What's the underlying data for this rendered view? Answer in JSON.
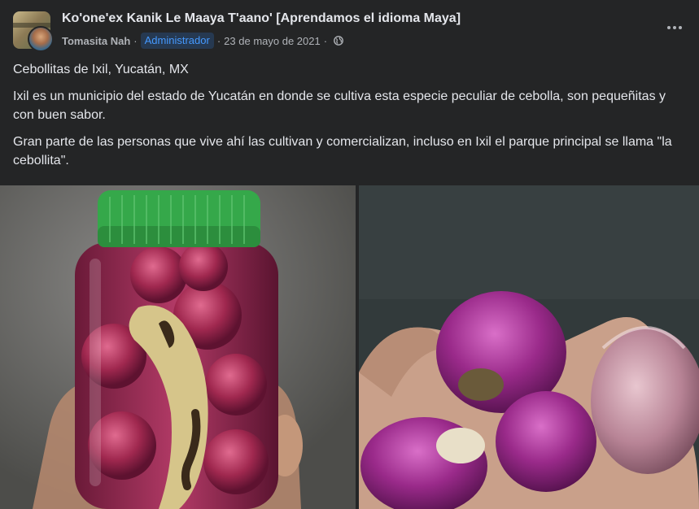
{
  "group": {
    "name": "Ko'one'ex Kanik Le Maaya T'aano' [Aprendamos el idioma Maya]"
  },
  "post": {
    "author": "Tomasita Nah",
    "role_badge": "Administrador",
    "date": "23 de mayo de 2021",
    "privacy_icon": "globe-icon",
    "more_icon": "more-options-icon",
    "paragraphs": [
      "Cebollitas de Ixil, Yucatán, MX",
      "Ixil es un municipio del estado de Yucatán en donde se cultiva esta especie peculiar de cebolla, son pequeñitas y con buen sabor.",
      "Gran parte de las personas que vive ahí las cultivan y comercializan, incluso en Ixil el parque principal se llama \"la cebollita\"."
    ],
    "photos": [
      {
        "icon": "photo-jar-of-pickled-onions"
      },
      {
        "icon": "photo-hand-holding-purple-onions"
      }
    ]
  },
  "colors": {
    "background": "#242526",
    "primary_text": "#e4e6eb",
    "secondary_text": "#b0b3b8",
    "badge_bg": "#263951",
    "badge_text": "#4599ff"
  }
}
